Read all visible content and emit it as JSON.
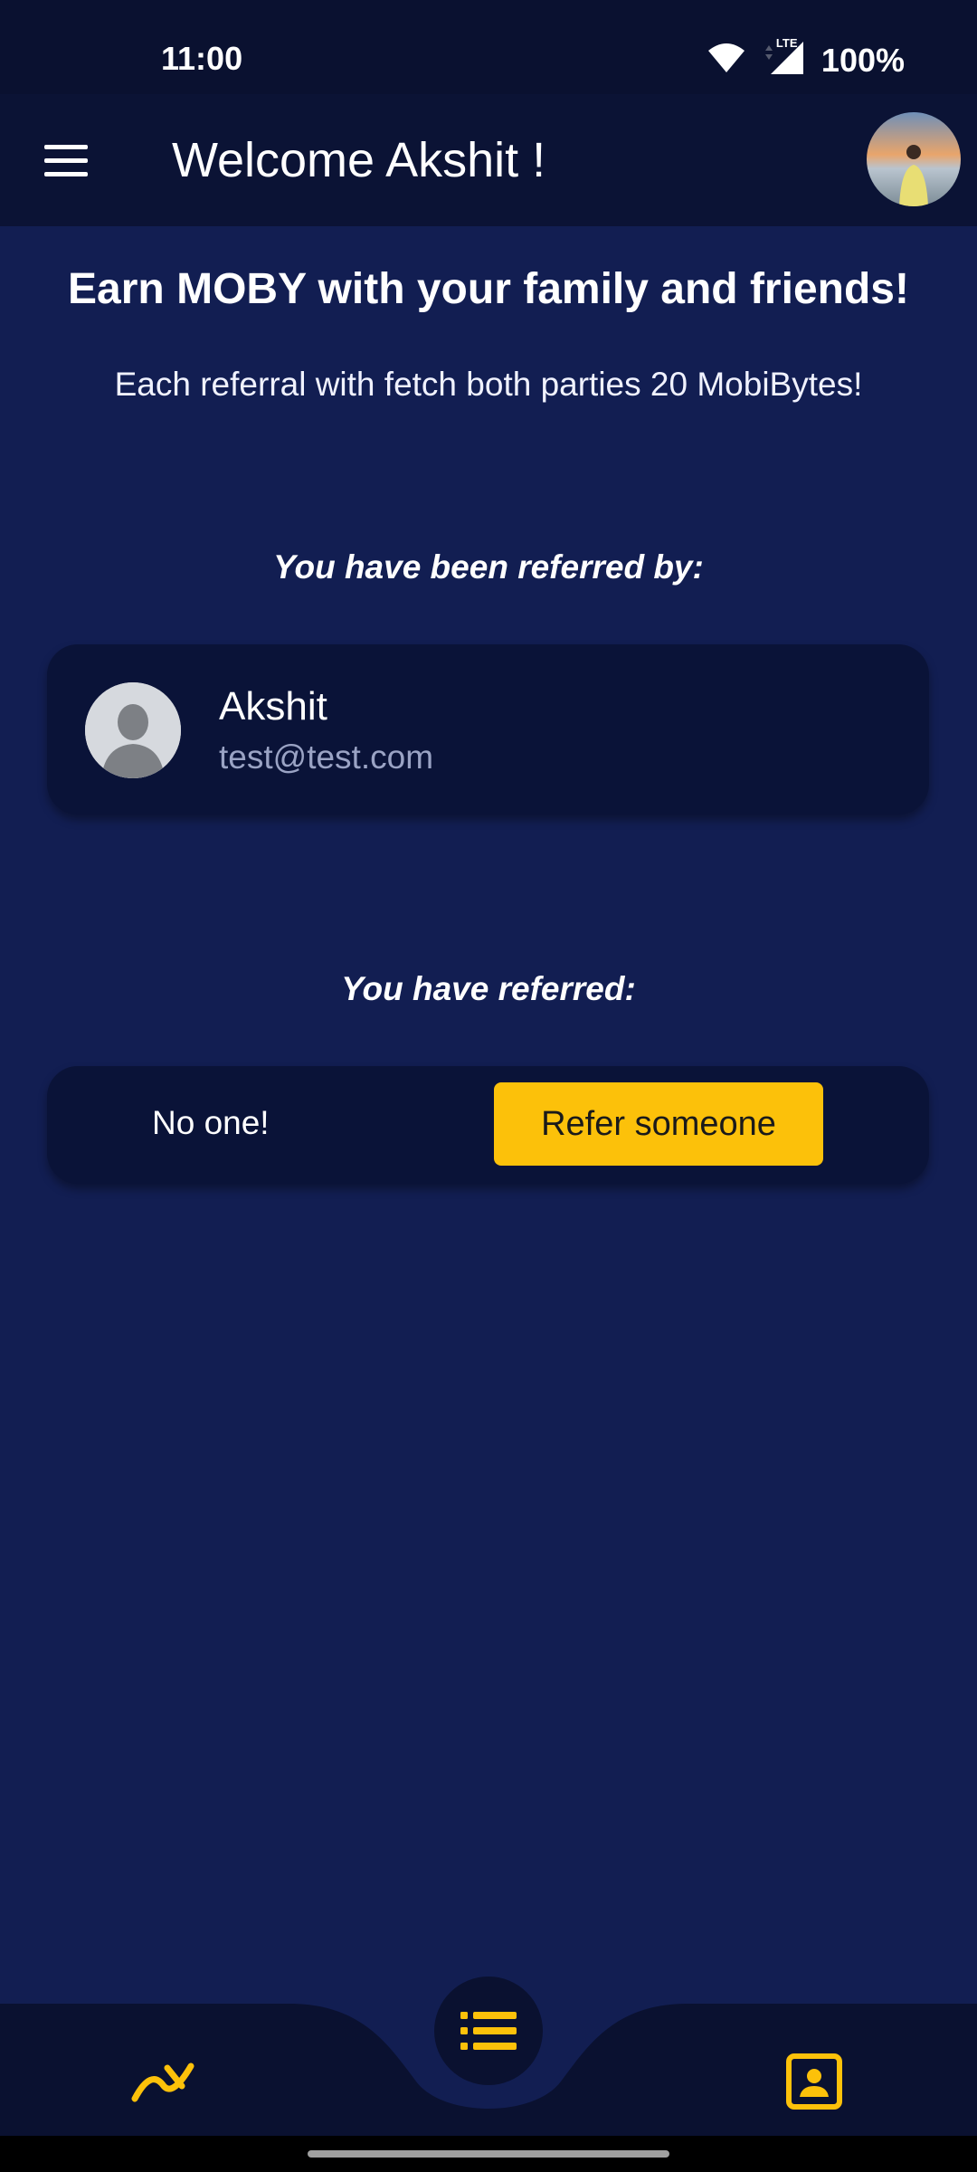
{
  "status_bar": {
    "time": "11:00",
    "battery": "100%",
    "network": "LTE",
    "icons": [
      "wifi-icon",
      "signal-icon"
    ]
  },
  "app_bar": {
    "title": "Welcome Akshit !",
    "menu_icon": "hamburger-menu-icon",
    "avatar": "profile-avatar"
  },
  "main": {
    "headline": "Earn MOBY with your family and friends!",
    "subline": "Each referral with fetch both parties 20 MobiBytes!",
    "referred_by_label": "You have been referred by:",
    "referrer": {
      "name": "Akshit",
      "email": "test@test.com",
      "avatar": "default-user-avatar"
    },
    "referred_label": "You have referred:",
    "referred_empty": "No one!",
    "refer_button": "Refer someone"
  },
  "bottom_nav": {
    "items": [
      "trending-icon",
      "list-icon",
      "contact-card-icon"
    ],
    "accent": "#fcc10a"
  },
  "colors": {
    "background": "#121e52",
    "app_bar": "#0b1335",
    "card": "#0a1338",
    "accent": "#fcc10a"
  }
}
